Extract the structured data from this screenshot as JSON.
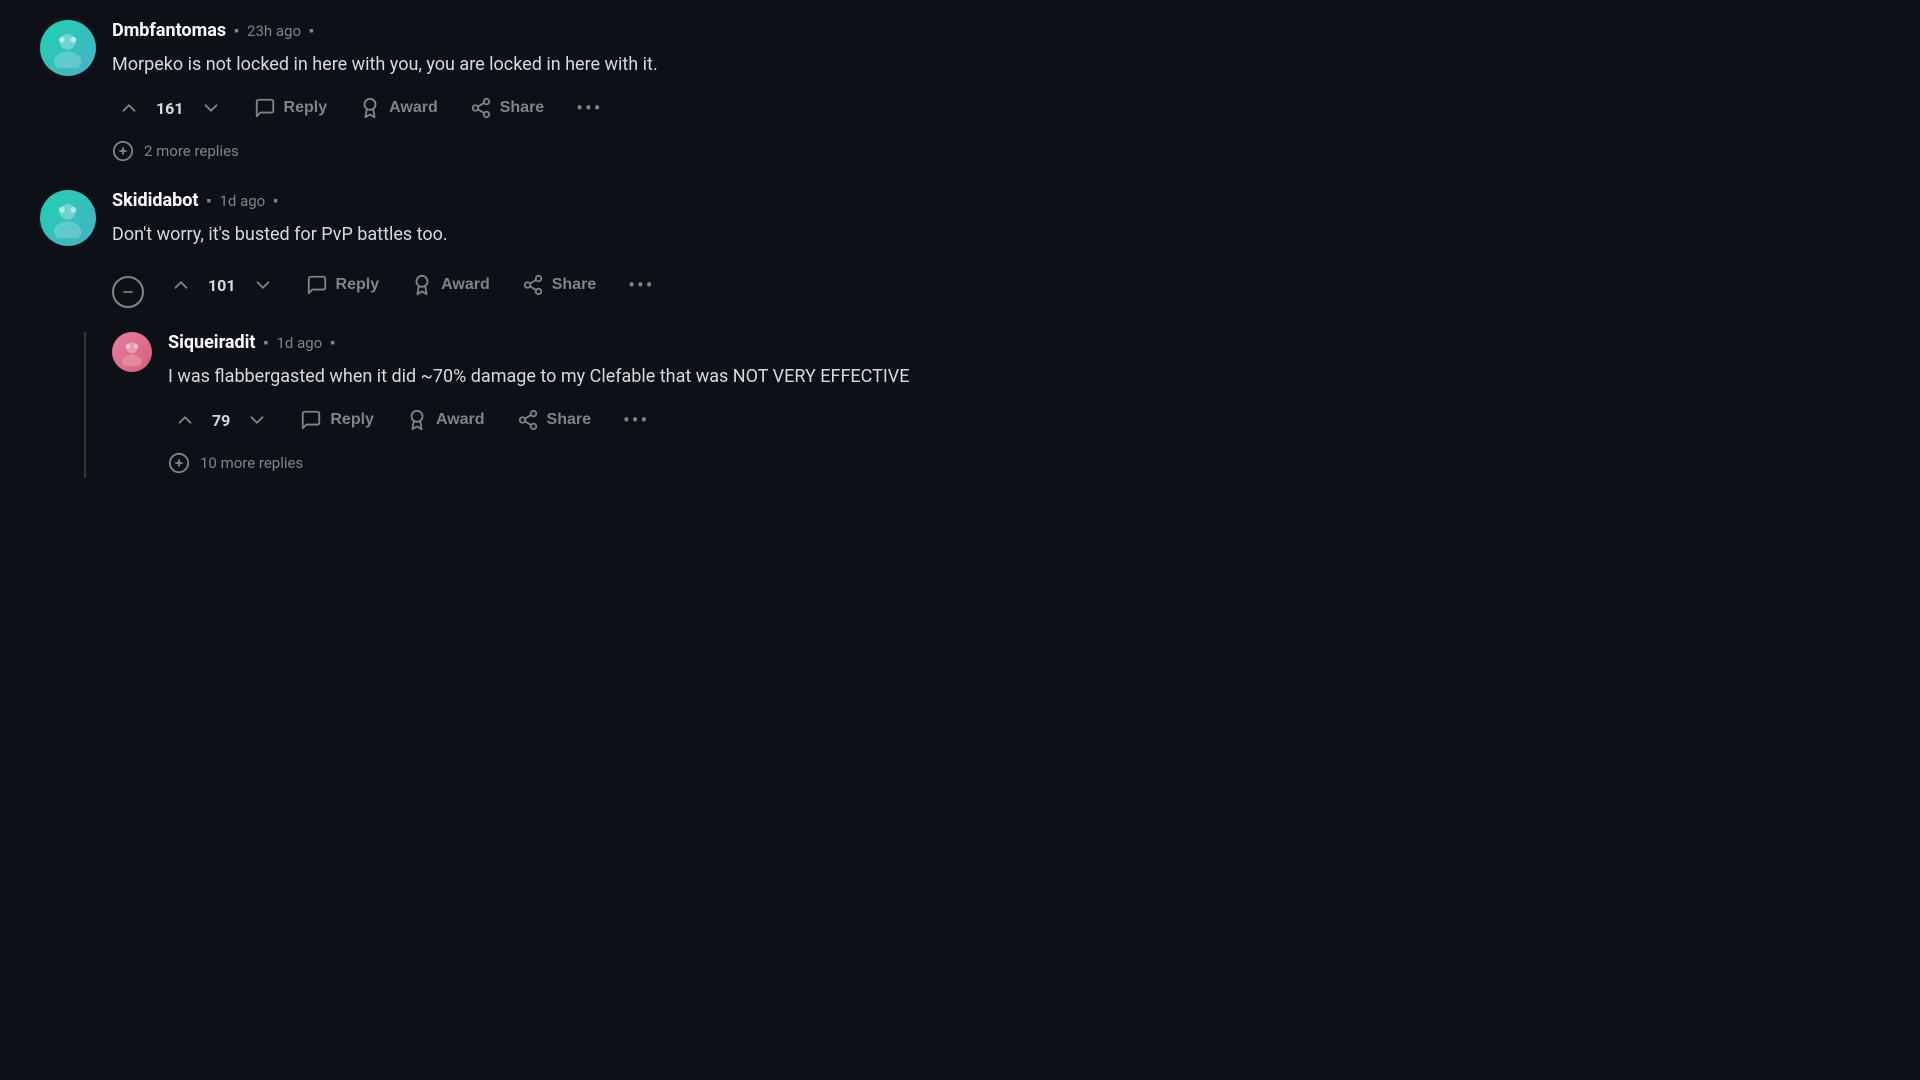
{
  "comments": [
    {
      "id": "comment-1",
      "username": "Dmbfantomas",
      "timestamp": "23h ago",
      "avatar_color": "teal",
      "text": "Morpeko is not locked in here with you, you are locked in here with it.",
      "upvotes": "161",
      "actions": {
        "reply": "Reply",
        "award": "Award",
        "share": "Share"
      },
      "more_replies": "2 more replies"
    },
    {
      "id": "comment-2",
      "username": "Skididabot",
      "timestamp": "1d ago",
      "avatar_color": "teal",
      "text": "Don't worry, it's busted for PvP battles too.",
      "upvotes": "101",
      "actions": {
        "reply": "Reply",
        "award": "Award",
        "share": "Share"
      },
      "replies": [
        {
          "id": "reply-1",
          "username": "Siqueiradit",
          "timestamp": "1d ago",
          "avatar_color": "pink",
          "text": "I was flabbergasted when it did ~70% damage to my Clefable that was NOT VERY EFFECTIVE",
          "upvotes": "79",
          "actions": {
            "reply": "Reply",
            "award": "Award",
            "share": "Share"
          },
          "more_replies": "10 more replies"
        }
      ]
    }
  ]
}
